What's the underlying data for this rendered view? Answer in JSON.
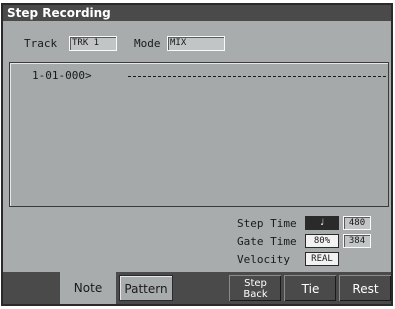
{
  "title": "Step Recording",
  "header": {
    "track_label": "Track",
    "track_value": "TRK 1",
    "mode_label": "Mode",
    "mode_value": "MIX"
  },
  "pane": {
    "position": "1-01-000>"
  },
  "params": {
    "step_time_label": "Step Time",
    "step_time_note": "♩",
    "step_time_value": "480",
    "gate_time_label": "Gate Time",
    "gate_time_pct": "80%",
    "gate_time_value": "384",
    "velocity_label": "Velocity",
    "velocity_value": "REAL"
  },
  "tabs": {
    "note": "Note",
    "pattern": "Pattern"
  },
  "buttons": {
    "step_back_line1": "Step",
    "step_back_line2": "Back",
    "tie": "Tie",
    "rest": "Rest"
  }
}
